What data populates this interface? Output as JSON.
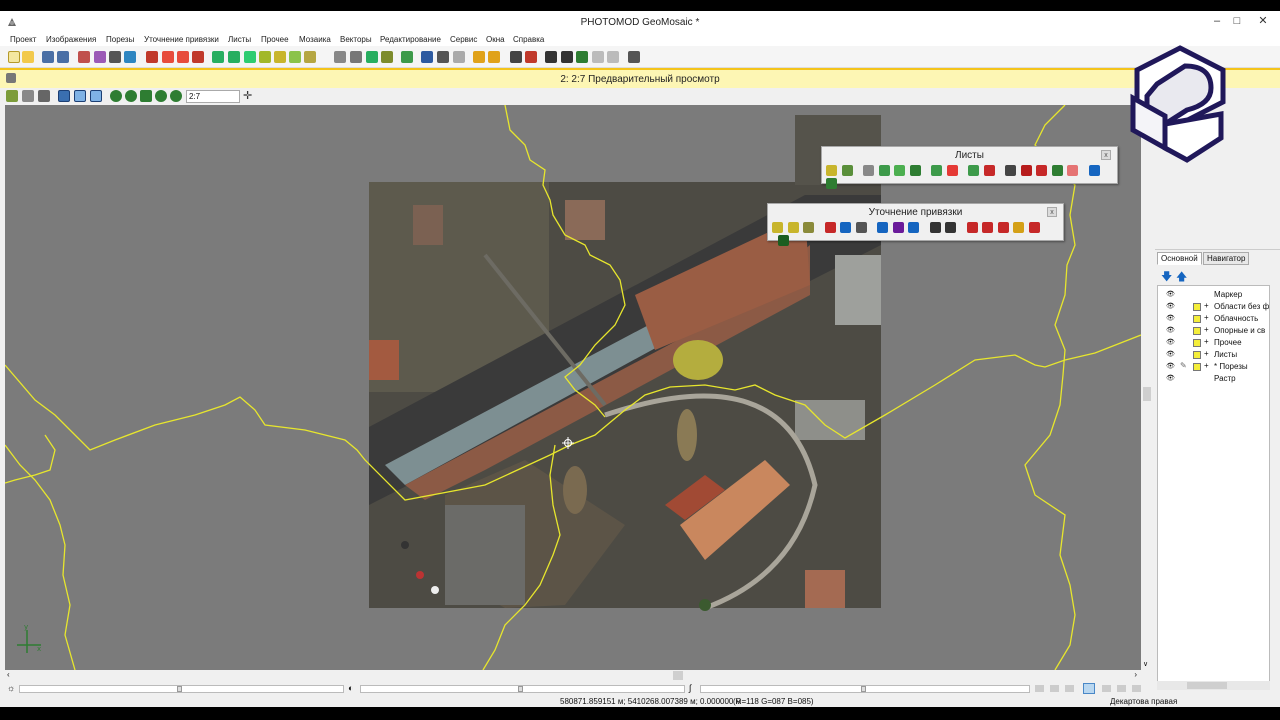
{
  "app": {
    "title": "PHOTOMOD GeoMosaic *"
  },
  "window_buttons": {
    "minimize": "–",
    "maximize": "□",
    "close": "✕"
  },
  "menu": [
    "Проект",
    "Изображения",
    "Порезы",
    "Уточнение привязки",
    "Листы",
    "Прочее",
    "Мозаика",
    "Векторы",
    "Редактирование",
    "Сервис",
    "Окна",
    "Справка"
  ],
  "inner_window": {
    "title": "2: 2:7 Предварительный просмотр"
  },
  "view_toolbar": {
    "zoom_value": "2:7"
  },
  "panels": {
    "sheets": {
      "title": "Листы",
      "close": "x"
    },
    "refine": {
      "title": "Уточнение привязки",
      "close": "x"
    }
  },
  "right_panel": {
    "tabs": [
      "Основной",
      "Навигатор"
    ],
    "layers": [
      {
        "label": "Маркер",
        "checkbox": false,
        "expandable": false
      },
      {
        "label": "Области без ф",
        "checkbox": true,
        "expandable": true
      },
      {
        "label": "Облачность",
        "checkbox": true,
        "expandable": true
      },
      {
        "label": "Опорные и св",
        "checkbox": true,
        "expandable": true
      },
      {
        "label": "Прочее",
        "checkbox": true,
        "expandable": true
      },
      {
        "label": "Листы",
        "checkbox": true,
        "expandable": true
      },
      {
        "label": "* Порезы",
        "checkbox": true,
        "expandable": true
      },
      {
        "label": "Растр",
        "checkbox": false,
        "expandable": false
      }
    ]
  },
  "status": {
    "coords": "580871.859151 м; 5410268.007389 м; 0.000000 м",
    "rgb": "(R=118 G=087 B=085)",
    "projection": "Декартова правая"
  },
  "colors": {
    "cutline": "#e7e62d",
    "accent": "#f4c41a",
    "viewport_bg": "#7b7b7b"
  }
}
